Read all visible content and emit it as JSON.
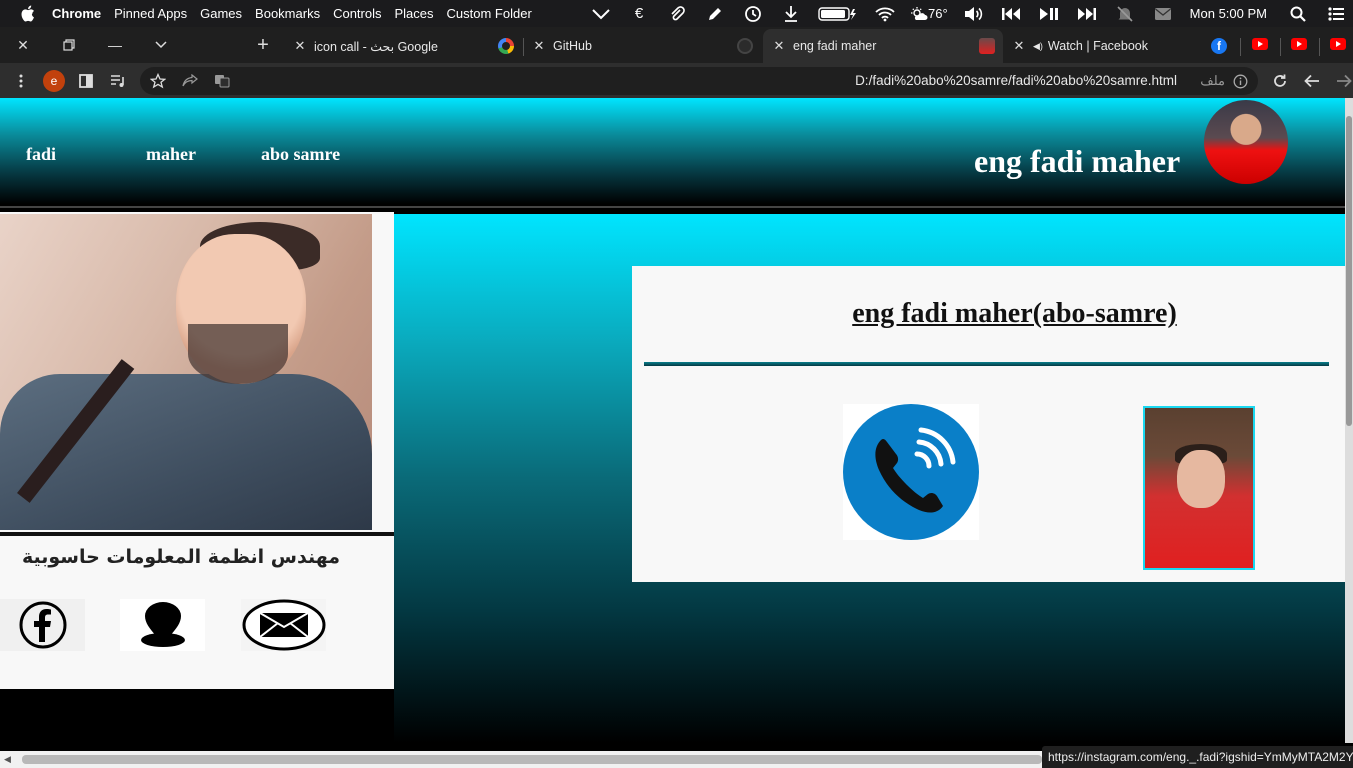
{
  "menubar": {
    "app": "Chrome",
    "items": [
      "Pinned Apps",
      "Games",
      "Bookmarks",
      "Controls",
      "Places",
      "Custom Folder"
    ],
    "temperature": "76°",
    "clock": "Mon 5:00 PM"
  },
  "tabs": [
    {
      "title": "icon call - بحث Google",
      "active": false
    },
    {
      "title": "GitHub",
      "active": false
    },
    {
      "title": "eng fadi maher",
      "active": true
    },
    {
      "title": "Watch | Facebook",
      "active": false
    }
  ],
  "address": {
    "url": "D:/fadi%20abo%20samre/fadi%20abo%20samre.html",
    "scheme_label": "ملف",
    "profile_initial": "e"
  },
  "page": {
    "nav": [
      "fadi",
      "maher",
      "abo samre"
    ],
    "site_title": "eng fadi maher",
    "job_title": "مهندس انظمة المعلومات حاسوبية",
    "card_title": "eng fadi maher(abo-samre)"
  },
  "status_url": "https://instagram.com/eng._.fadi?igshid=YmMyMTA2M2Y=",
  "colors": {
    "accent_cyan": "#00e5ff",
    "call_blue": "#0a7fc8",
    "youtube_red": "#ff0000",
    "facebook_blue": "#1877f2"
  }
}
